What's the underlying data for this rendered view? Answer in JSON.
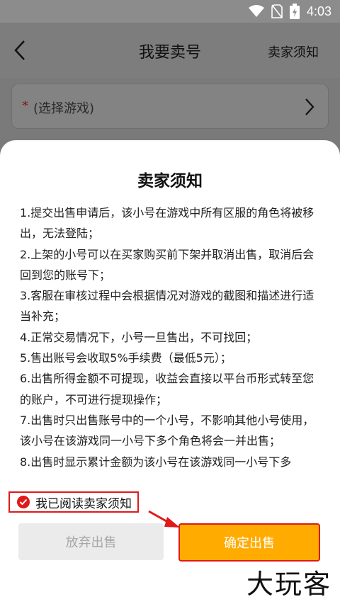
{
  "status_bar": {
    "time": "4:03"
  },
  "header": {
    "title": "我要卖号",
    "link_label": "卖家须知"
  },
  "game_select": {
    "required_mark": "*",
    "placeholder": "(选择游戏)"
  },
  "sheet": {
    "title": "卖家须知",
    "rules": [
      "1.提交出售申请后，该小号在游戏中所有区服的角色将被移出，无法登陆；",
      "2.上架的小号可以在买家购买前下架并取消出售，取消后会回到您的账号下；",
      "3.客服在审核过程中会根据情况对游戏的截图和描述进行适当补充；",
      "4.正常交易情况下，小号一旦售出，不可找回；",
      "5.售出账号会收取5%手续费（最低5元）；",
      "6.出售所得金额不可提现，收益会直接以平台币形式转至您的账户，不可进行提现操作；",
      "7.出售时只出售账号中的一个小号，不影响其他小号使用，该小号在该游戏同一小号下多个角色将会一并出售；",
      "8.出售时显示累计金额为该小号在该游戏同一小号下多"
    ],
    "agree_label": "我已阅读卖家须知",
    "abandon_label": "放弃出售",
    "confirm_label": "确定出售"
  },
  "watermark": "大玩客",
  "colors": {
    "accent": "#ffab00",
    "highlight": "#e01919"
  }
}
